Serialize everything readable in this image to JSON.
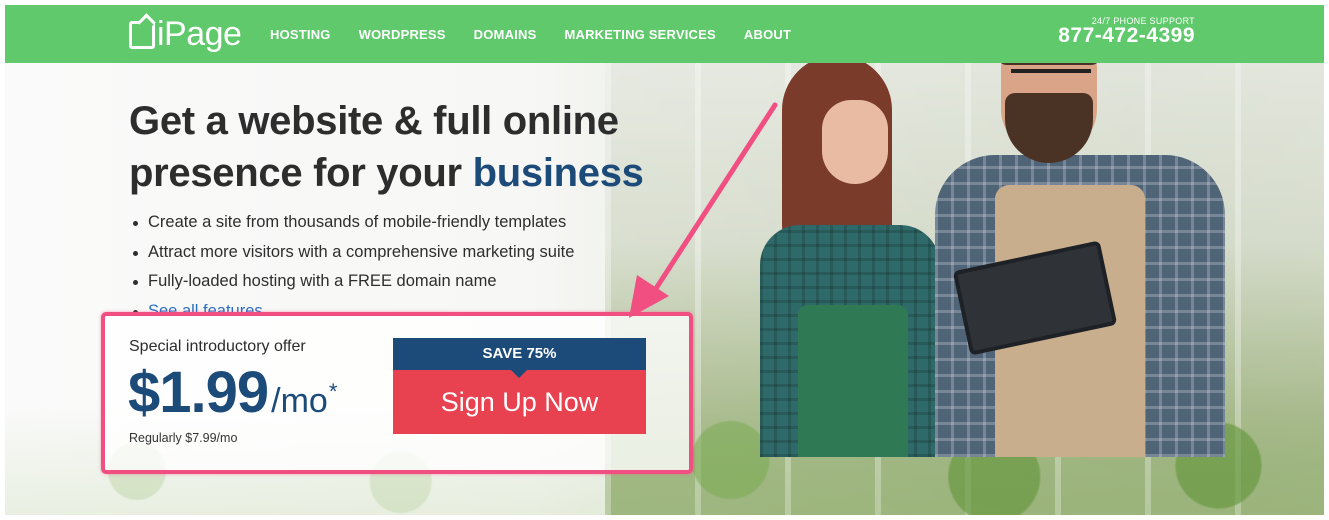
{
  "header": {
    "logo": "iPage",
    "nav": [
      "HOSTING",
      "WORDPRESS",
      "DOMAINS",
      "MARKETING SERVICES",
      "ABOUT"
    ],
    "support_label": "24/7 PHONE SUPPORT",
    "support_phone": "877-472-4399"
  },
  "hero": {
    "headline_line1": "Get a website & full online",
    "headline_line2_prefix": "presence for your",
    "headline_accent": "business",
    "features": [
      "Create a site from thousands of mobile-friendly templates",
      "Attract more visitors with a comprehensive marketing suite",
      "Fully-loaded hosting with a FREE domain name"
    ],
    "features_link": "See all features"
  },
  "offer": {
    "label": "Special introductory offer",
    "price": "$1.99",
    "per": "/mo",
    "asterisk": "*",
    "regular": "Regularly $7.99/mo",
    "save": "SAVE 75%",
    "cta": "Sign Up Now"
  },
  "colors": {
    "nav_green": "#5fc96b",
    "brand_blue": "#1c4b7a",
    "cta_red": "#e8414f",
    "annotation_pink": "#f14f82",
    "link_blue": "#2a6fc4"
  }
}
